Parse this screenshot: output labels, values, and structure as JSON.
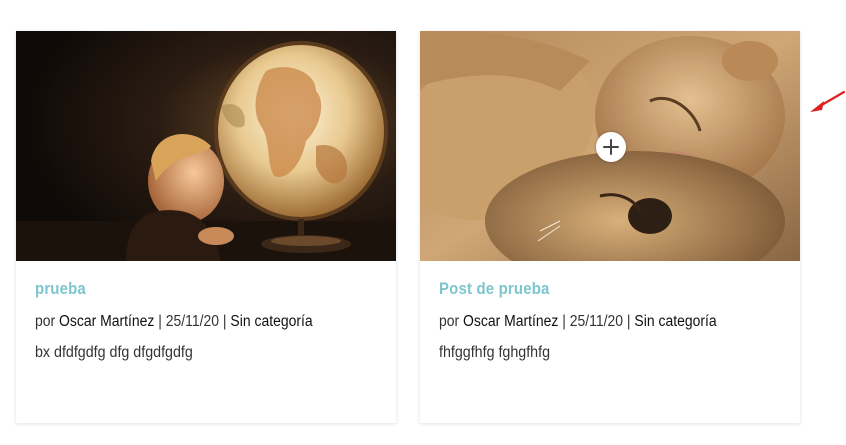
{
  "posts": [
    {
      "title": "prueba",
      "meta_prefix": "por ",
      "author": "Oscar Martínez",
      "sep1": " | ",
      "date": "25/11/20",
      "sep2": " | ",
      "category": "Sin categoría",
      "excerpt": "bx dfdfgdfg dfg dfgdfgdfg"
    },
    {
      "title": "Post de prueba",
      "meta_prefix": "por ",
      "author": "Oscar Martínez",
      "sep1": " | ",
      "date": "25/11/20",
      "sep2": " | ",
      "category": "Sin categoría",
      "excerpt": "fhfggfhfg fghgfhfg"
    }
  ],
  "colors": {
    "title_accent": "#7cc6cd",
    "annotation_arrow": "#e02020"
  },
  "icons": {
    "zoom": "plus-circle-icon",
    "annotation": "red-arrow-icon"
  }
}
